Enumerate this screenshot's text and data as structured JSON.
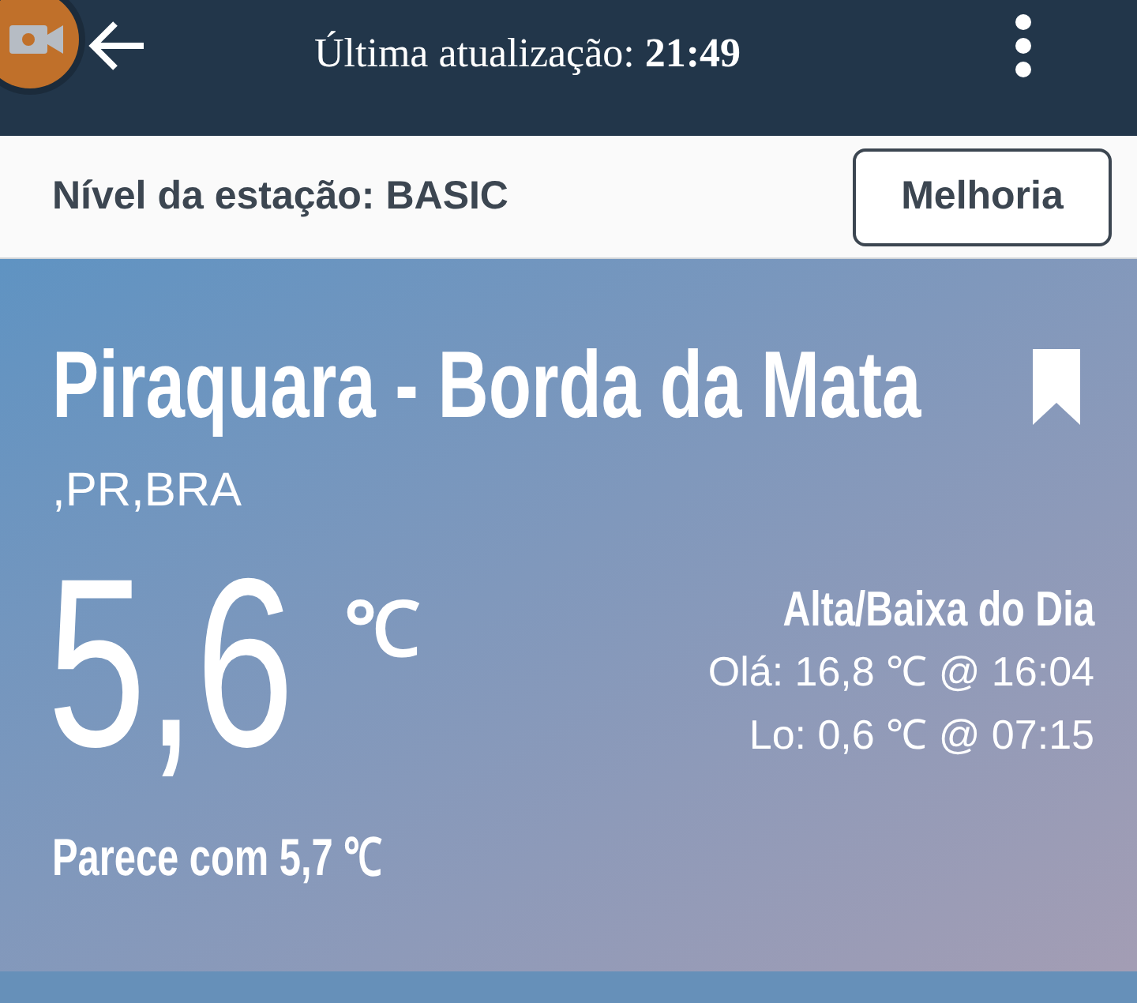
{
  "header": {
    "title": "Última atualização: **21:49**"
  },
  "station": {
    "label": "Nível da estação: BASIC",
    "button": "Melhoria"
  },
  "location": {
    "name": "Piraquara - Borda da Mata",
    "region": ",PR,BRA"
  },
  "current": {
    "temperature": "5,6",
    "unit": "℃",
    "feels_like": "Parece com 5,7 ℃"
  },
  "high_low": {
    "title": "Alta/Baixa do Dia",
    "lines": [
      "Olá: 16,8 ℃ @ 16:04",
      "Lo: 0,6 ℃ @ 07:15"
    ]
  }
}
